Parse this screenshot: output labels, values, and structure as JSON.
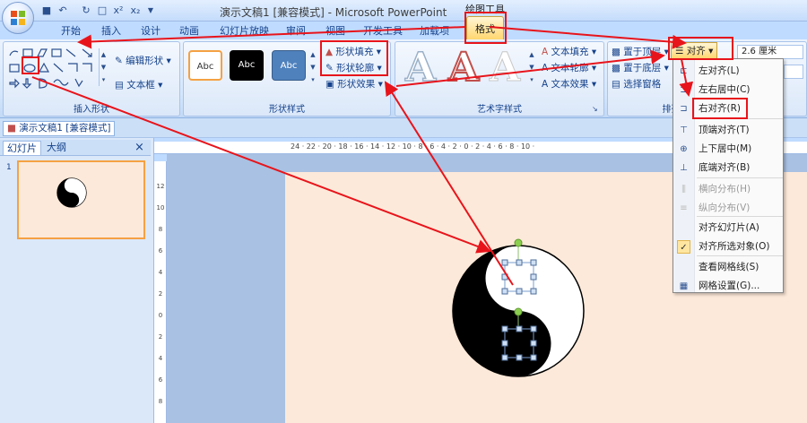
{
  "window": {
    "title": "演示文稿1 [兼容模式] - Microsoft PowerPoint",
    "contextual_tools_label": "绘图工具"
  },
  "qat": {
    "save": "save-icon",
    "undo": "undo-icon",
    "redo": "redo-icon",
    "preview": "preview-icon",
    "superscript": "x²",
    "subscript": "x₂"
  },
  "tabs": [
    "开始",
    "插入",
    "设计",
    "动画",
    "幻灯片放映",
    "审阅",
    "视图",
    "开发工具",
    "加载项",
    "格式"
  ],
  "ribbon": {
    "insert_shapes": {
      "label": "插入形状",
      "edit_shape": "编辑形状",
      "text_box": "文本框"
    },
    "shape_styles": {
      "label": "形状样式",
      "swatches": [
        "Abc",
        "Abc",
        "Abc"
      ],
      "fill": "形状填充",
      "outline": "形状轮廓",
      "effects": "形状效果"
    },
    "wordart_styles": {
      "label": "艺术字样式",
      "letter": "A",
      "text_fill": "文本填充",
      "text_outline": "文本轮廓",
      "text_effects": "文本效果"
    },
    "arrange": {
      "label": "排列",
      "bring_front": "置于顶层",
      "send_back": "置于底层",
      "selection_pane": "选择窗格",
      "align": "对齐",
      "size_value": "2.6 厘米"
    }
  },
  "document_tab": "演示文稿1 [兼容模式]",
  "left_pane": {
    "tab_slides": "幻灯片",
    "tab_outline": "大纲",
    "close": "×",
    "slide_number": "1"
  },
  "ruler": {
    "horizontal": "24 · 22 · 20 · 18 · 16 · 14 · 12 · 10 · 8 · 6 · 4 · 2 · 0 · 2 · 4 · 6 · 8 · 10 ·",
    "vertical": [
      "12",
      "10",
      "8",
      "6",
      "4",
      "2",
      "0",
      "2",
      "4",
      "6",
      "8"
    ]
  },
  "align_menu": {
    "items": [
      {
        "label": "左对齐(L)",
        "icon": "align-left-icon",
        "enabled": true
      },
      {
        "label": "左右居中(C)",
        "icon": "align-center-icon",
        "enabled": true
      },
      {
        "label": "右对齐(R)",
        "icon": "align-right-icon",
        "enabled": true
      },
      {
        "label": "顶端对齐(T)",
        "icon": "align-top-icon",
        "enabled": true
      },
      {
        "label": "上下居中(M)",
        "icon": "align-middle-icon",
        "enabled": true
      },
      {
        "label": "底端对齐(B)",
        "icon": "align-bottom-icon",
        "enabled": true
      },
      {
        "label": "横向分布(H)",
        "icon": "distribute-horizontal-icon",
        "enabled": false
      },
      {
        "label": "纵向分布(V)",
        "icon": "distribute-vertical-icon",
        "enabled": false
      },
      {
        "label": "对齐幻灯片(A)",
        "icon": "",
        "enabled": true
      },
      {
        "label": "对齐所选对象(O)",
        "icon": "check-icon",
        "enabled": true
      },
      {
        "label": "查看网格线(S)",
        "icon": "",
        "enabled": true
      },
      {
        "label": "网格设置(G)...",
        "icon": "grid-settings-icon",
        "enabled": true
      }
    ]
  },
  "colors": {
    "annotation_red": "#e8141b",
    "slide_background": "#fde9d9",
    "ribbon_blue": "#bfdbff"
  }
}
